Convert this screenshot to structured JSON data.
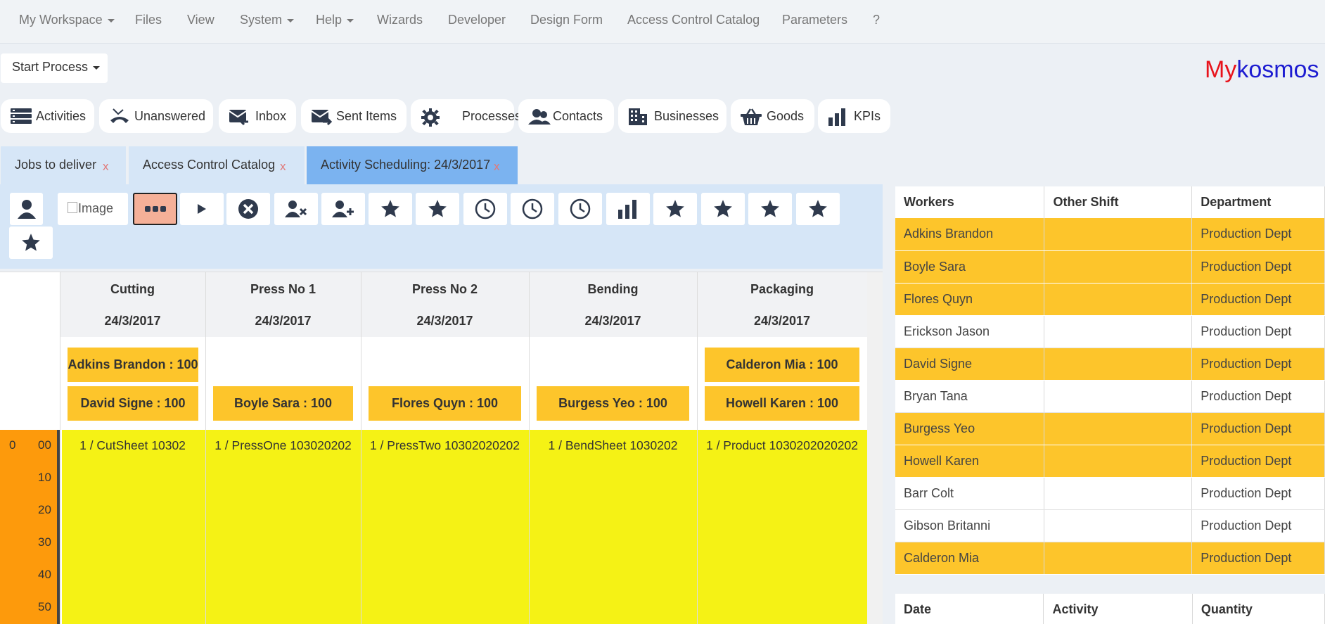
{
  "menu": {
    "items": [
      {
        "label": "My Workspace",
        "dropdown": true
      },
      {
        "label": "Files",
        "dropdown": false
      },
      {
        "label": "View",
        "dropdown": false
      },
      {
        "label": "System",
        "dropdown": true
      },
      {
        "label": "Help",
        "dropdown": true
      },
      {
        "label": "Wizards",
        "dropdown": false
      },
      {
        "label": "Developer",
        "dropdown": false
      },
      {
        "label": "Design Form",
        "dropdown": false
      },
      {
        "label": "Access Control Catalog",
        "dropdown": false
      },
      {
        "label": "Parameters",
        "dropdown": false
      },
      {
        "label": "?",
        "dropdown": false
      }
    ]
  },
  "start_process": {
    "label": "Start Process"
  },
  "brand": {
    "part1": "My",
    "part2": "kosmos",
    "color1": "#e8131b",
    "color2": "#1d1cd1"
  },
  "shortcuts": [
    {
      "label": "Activities",
      "icon": "activities-list-icon"
    },
    {
      "label": "Unanswered",
      "icon": "missed-call-icon"
    },
    {
      "label": "Inbox",
      "icon": "inbox-icon"
    },
    {
      "label": "Sent Items",
      "icon": "sent-items-icon"
    },
    {
      "label": "Processes",
      "icon": "gear-icon"
    },
    {
      "label": "Contacts",
      "icon": "contacts-icon"
    },
    {
      "label": "Businesses",
      "icon": "building-icon"
    },
    {
      "label": "Goods",
      "icon": "basket-icon"
    },
    {
      "label": "KPIs",
      "icon": "bar-chart-icon"
    }
  ],
  "doc_tabs": [
    {
      "label": "Jobs to deliver",
      "close": "x",
      "active": false
    },
    {
      "label": "Access Control Catalog",
      "close": "x",
      "active": false
    },
    {
      "label": "Activity Scheduling: 24/3/2017",
      "close": "x",
      "active": true
    }
  ],
  "toolbar": {
    "image_alt": "Image",
    "buttons": [
      "user-icon",
      "image-placeholder",
      "more-icon",
      "play-icon",
      "cancel-circle-icon",
      "remove-user-icon",
      "add-user-icon",
      "star-icon",
      "star-icon",
      "clock-icon",
      "clock-icon",
      "clock-icon",
      "bar-chart-icon",
      "star-icon",
      "star-icon",
      "star-icon",
      "star-icon",
      "star-icon"
    ]
  },
  "schedule": {
    "columns": [
      {
        "name": "Cutting",
        "date": "24/3/2017",
        "workers": [
          "Adkins Brandon : 100",
          "David Signe : 100"
        ],
        "cell": "1 / CutSheet 10302"
      },
      {
        "name": "Press No 1",
        "date": "24/3/2017",
        "workers": [
          "Boyle Sara : 100"
        ],
        "cell": "1 / PressOne 103020202"
      },
      {
        "name": "Press No 2",
        "date": "24/3/2017",
        "workers": [
          "Flores Quyn : 100"
        ],
        "cell": "1 / PressTwo 10302020202"
      },
      {
        "name": "Bending",
        "date": "24/3/2017",
        "workers": [
          "Burgess Yeo : 100"
        ],
        "cell": "1 / BendSheet 1030202"
      },
      {
        "name": "Packaging",
        "date": "24/3/2017",
        "workers": [
          "Calderon Mia : 100",
          "Howell Karen : 100"
        ],
        "cell": "1 / Product 1030202020202"
      }
    ],
    "hour": "0",
    "minutes": [
      "00",
      "10",
      "20",
      "30",
      "40",
      "50"
    ]
  },
  "workers_table": {
    "headers": [
      "Workers",
      "Other Shift",
      "Department"
    ],
    "rows": [
      {
        "name": "Adkins Brandon",
        "other_shift": "",
        "department": "Production Dept",
        "highlight": true
      },
      {
        "name": "Boyle Sara",
        "other_shift": "",
        "department": "Production Dept",
        "highlight": true
      },
      {
        "name": "Flores Quyn",
        "other_shift": "",
        "department": "Production Dept",
        "highlight": true
      },
      {
        "name": "Erickson Jason",
        "other_shift": "",
        "department": "Production Dept",
        "highlight": false
      },
      {
        "name": "David Signe",
        "other_shift": "",
        "department": "Production Dept",
        "highlight": true
      },
      {
        "name": "Bryan Tana",
        "other_shift": "",
        "department": "Production Dept",
        "highlight": false
      },
      {
        "name": "Burgess Yeo",
        "other_shift": "",
        "department": "Production Dept",
        "highlight": true
      },
      {
        "name": "Howell Karen",
        "other_shift": "",
        "department": "Production Dept",
        "highlight": true
      },
      {
        "name": "Barr Colt",
        "other_shift": "",
        "department": "Production Dept",
        "highlight": false
      },
      {
        "name": "Gibson Britanni",
        "other_shift": "",
        "department": "Production Dept",
        "highlight": false
      },
      {
        "name": "Calderon Mia",
        "other_shift": "",
        "department": "Production Dept",
        "highlight": true
      }
    ]
  },
  "activity_table": {
    "headers": [
      "Date",
      "Activity",
      "Quantity"
    ]
  },
  "colors": {
    "highlight": "#fdc52b",
    "schedule_fill": "#f5f215",
    "time_gutter": "#fd9a0c",
    "active_tab": "#7bb3f0",
    "selected_button": "#f5b098"
  }
}
